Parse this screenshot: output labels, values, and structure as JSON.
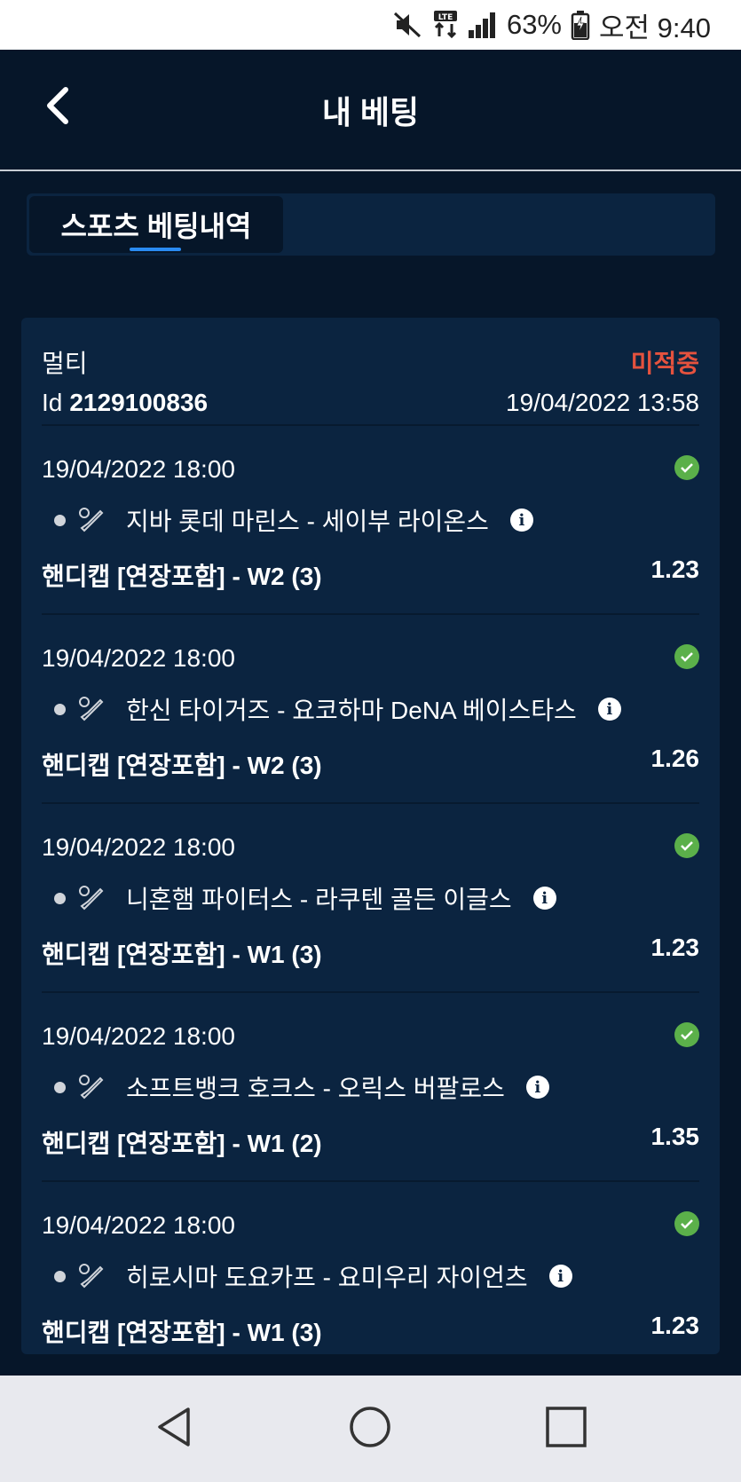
{
  "status_bar": {
    "icons": [
      "mute-icon",
      "lte-icon",
      "signal-icon",
      "battery-icon"
    ],
    "battery": "63%",
    "time": "오전 9:40"
  },
  "header": {
    "title": "내 베팅",
    "back_icon": "chevron-left-icon"
  },
  "tabs": [
    {
      "label": "스포츠 베팅내역",
      "active": true
    }
  ],
  "bet": {
    "type": "멀티",
    "status": "미적중",
    "id_label": "Id",
    "id": "2129100836",
    "placed_at": "19/04/2022 13:58",
    "legs": [
      {
        "time": "19/04/2022 18:00",
        "match": "지바 롯데 마린스 - 세이부 라이온스",
        "market": "핸디캡 [연장포함] - W2 (3)",
        "odds": "1.23",
        "result_icon": "check-circle-icon",
        "sport_icon": "baseball-icon"
      },
      {
        "time": "19/04/2022 18:00",
        "match": "한신 타이거즈 - 요코하마 DeNA 베이스타스",
        "market": "핸디캡 [연장포함] - W2 (3)",
        "odds": "1.26",
        "result_icon": "check-circle-icon",
        "sport_icon": "baseball-icon"
      },
      {
        "time": "19/04/2022 18:00",
        "match": "니혼햄 파이터스 - 라쿠텐 골든 이글스",
        "market": "핸디캡 [연장포함] - W1 (3)",
        "odds": "1.23",
        "result_icon": "check-circle-icon",
        "sport_icon": "baseball-icon"
      },
      {
        "time": "19/04/2022 18:00",
        "match": "소프트뱅크 호크스 - 오릭스 버팔로스",
        "market": "핸디캡 [연장포함] - W1 (2)",
        "odds": "1.35",
        "result_icon": "check-circle-icon",
        "sport_icon": "baseball-icon"
      },
      {
        "time": "19/04/2022 18:00",
        "match": "히로시마 도요카프 - 요미우리 자이언츠",
        "market": "핸디캡 [연장포함] - W1 (3)",
        "odds": "1.23",
        "result_icon": "check-circle-icon",
        "sport_icon": "baseball-icon"
      }
    ]
  },
  "nav_bar": {
    "buttons": [
      "back-triangle-icon",
      "home-circle-icon",
      "recents-square-icon"
    ]
  },
  "colors": {
    "background": "#061629",
    "card": "#0b2440",
    "status_lost": "#e5523e",
    "check": "#5bb04a",
    "tab_indicator": "#2a8bf2"
  }
}
